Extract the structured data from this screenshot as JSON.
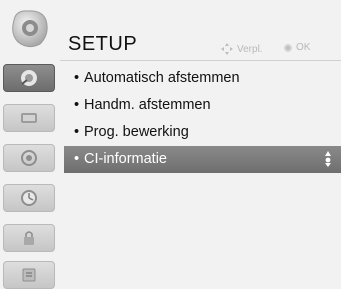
{
  "header": {
    "title": "SETUP",
    "hint_nav": "Verpl.",
    "hint_ok": "OK"
  },
  "sidebar": {
    "items": [
      {
        "icon": "settings-icon",
        "active": true
      },
      {
        "icon": "picture-icon",
        "active": false
      },
      {
        "icon": "sound-icon",
        "active": false
      },
      {
        "icon": "time-icon",
        "active": false
      },
      {
        "icon": "lock-icon",
        "active": false
      },
      {
        "icon": "option-icon",
        "active": false
      }
    ]
  },
  "menu": {
    "items": [
      {
        "label": "Automatisch afstemmen",
        "selected": false
      },
      {
        "label": "Handm. afstemmen",
        "selected": false
      },
      {
        "label": "Prog. bewerking",
        "selected": false
      },
      {
        "label": "CI-informatie",
        "selected": true
      }
    ],
    "bullet": "•"
  },
  "colors": {
    "selected_bg": "#7c7c7c",
    "background": "#f2f2f2",
    "hint_text": "#b8b8b8"
  }
}
